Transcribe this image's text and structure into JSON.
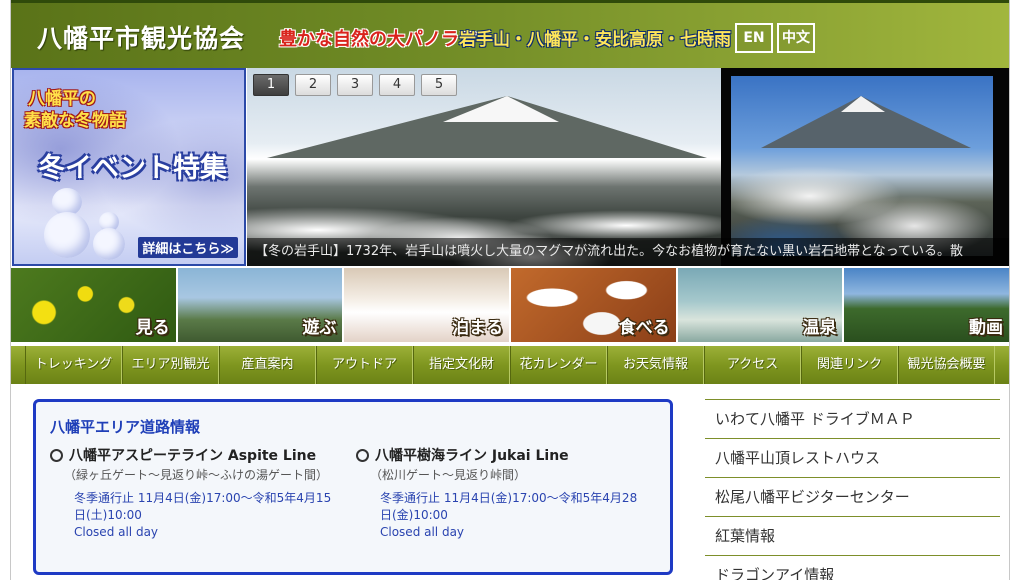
{
  "header": {
    "site_title": "八幡平市観光協会",
    "tagline_a": "豊かな自然の大パノラマ",
    "tagline_b": "岩手山・八幡平・安比高原・七時雨",
    "lang_en": "EN",
    "lang_zh": "中文"
  },
  "event_banner": {
    "line1": "八幡平の",
    "line2": "素敵な冬物語",
    "line3": "冬イベント特集",
    "more": "詳細はこちら≫"
  },
  "slideshow": {
    "tabs": [
      "1",
      "2",
      "3",
      "4",
      "5"
    ],
    "active_tab": "1",
    "caption": "【冬の岩手山】1732年、岩手山は噴火し大量のマグマが流れ出た。今なお植物が育たない黒い岩石地帯となっている。散"
  },
  "tiles": [
    {
      "label": "見る"
    },
    {
      "label": "遊ぶ"
    },
    {
      "label": "泊まる"
    },
    {
      "label": "食べる"
    },
    {
      "label": "温泉"
    },
    {
      "label": "動画"
    }
  ],
  "nav": [
    "トレッキング",
    "エリア別観光",
    "産直案内",
    "アウトドア",
    "指定文化財",
    "花カレンダー",
    "お天気情報",
    "アクセス",
    "関連リンク",
    "観光協会概要"
  ],
  "road_info": {
    "title": "八幡平エリア道路情報",
    "roads": [
      {
        "name": "八幡平アスピーテライン Aspite Line",
        "route": "（緑ヶ丘ゲート～見返り峠～ふけの湯ゲート間）",
        "status": "冬季通行止 11月4日(金)17:00～令和5年4月15日(土)10:00",
        "status_en": "Closed all day"
      },
      {
        "name": "八幡平樹海ライン Jukai Line",
        "route": "（松川ゲート～見返り峠間）",
        "status": "冬季通行止 11月4日(金)17:00～令和5年4月28日(金)10:00",
        "status_en": "Closed all day"
      }
    ]
  },
  "side_links": [
    "いわて八幡平 ドライブＭＡＰ",
    "八幡平山頂レストハウス",
    "松尾八幡平ビジターセンター",
    "紅葉情報",
    "ドラゴンアイ情報"
  ]
}
